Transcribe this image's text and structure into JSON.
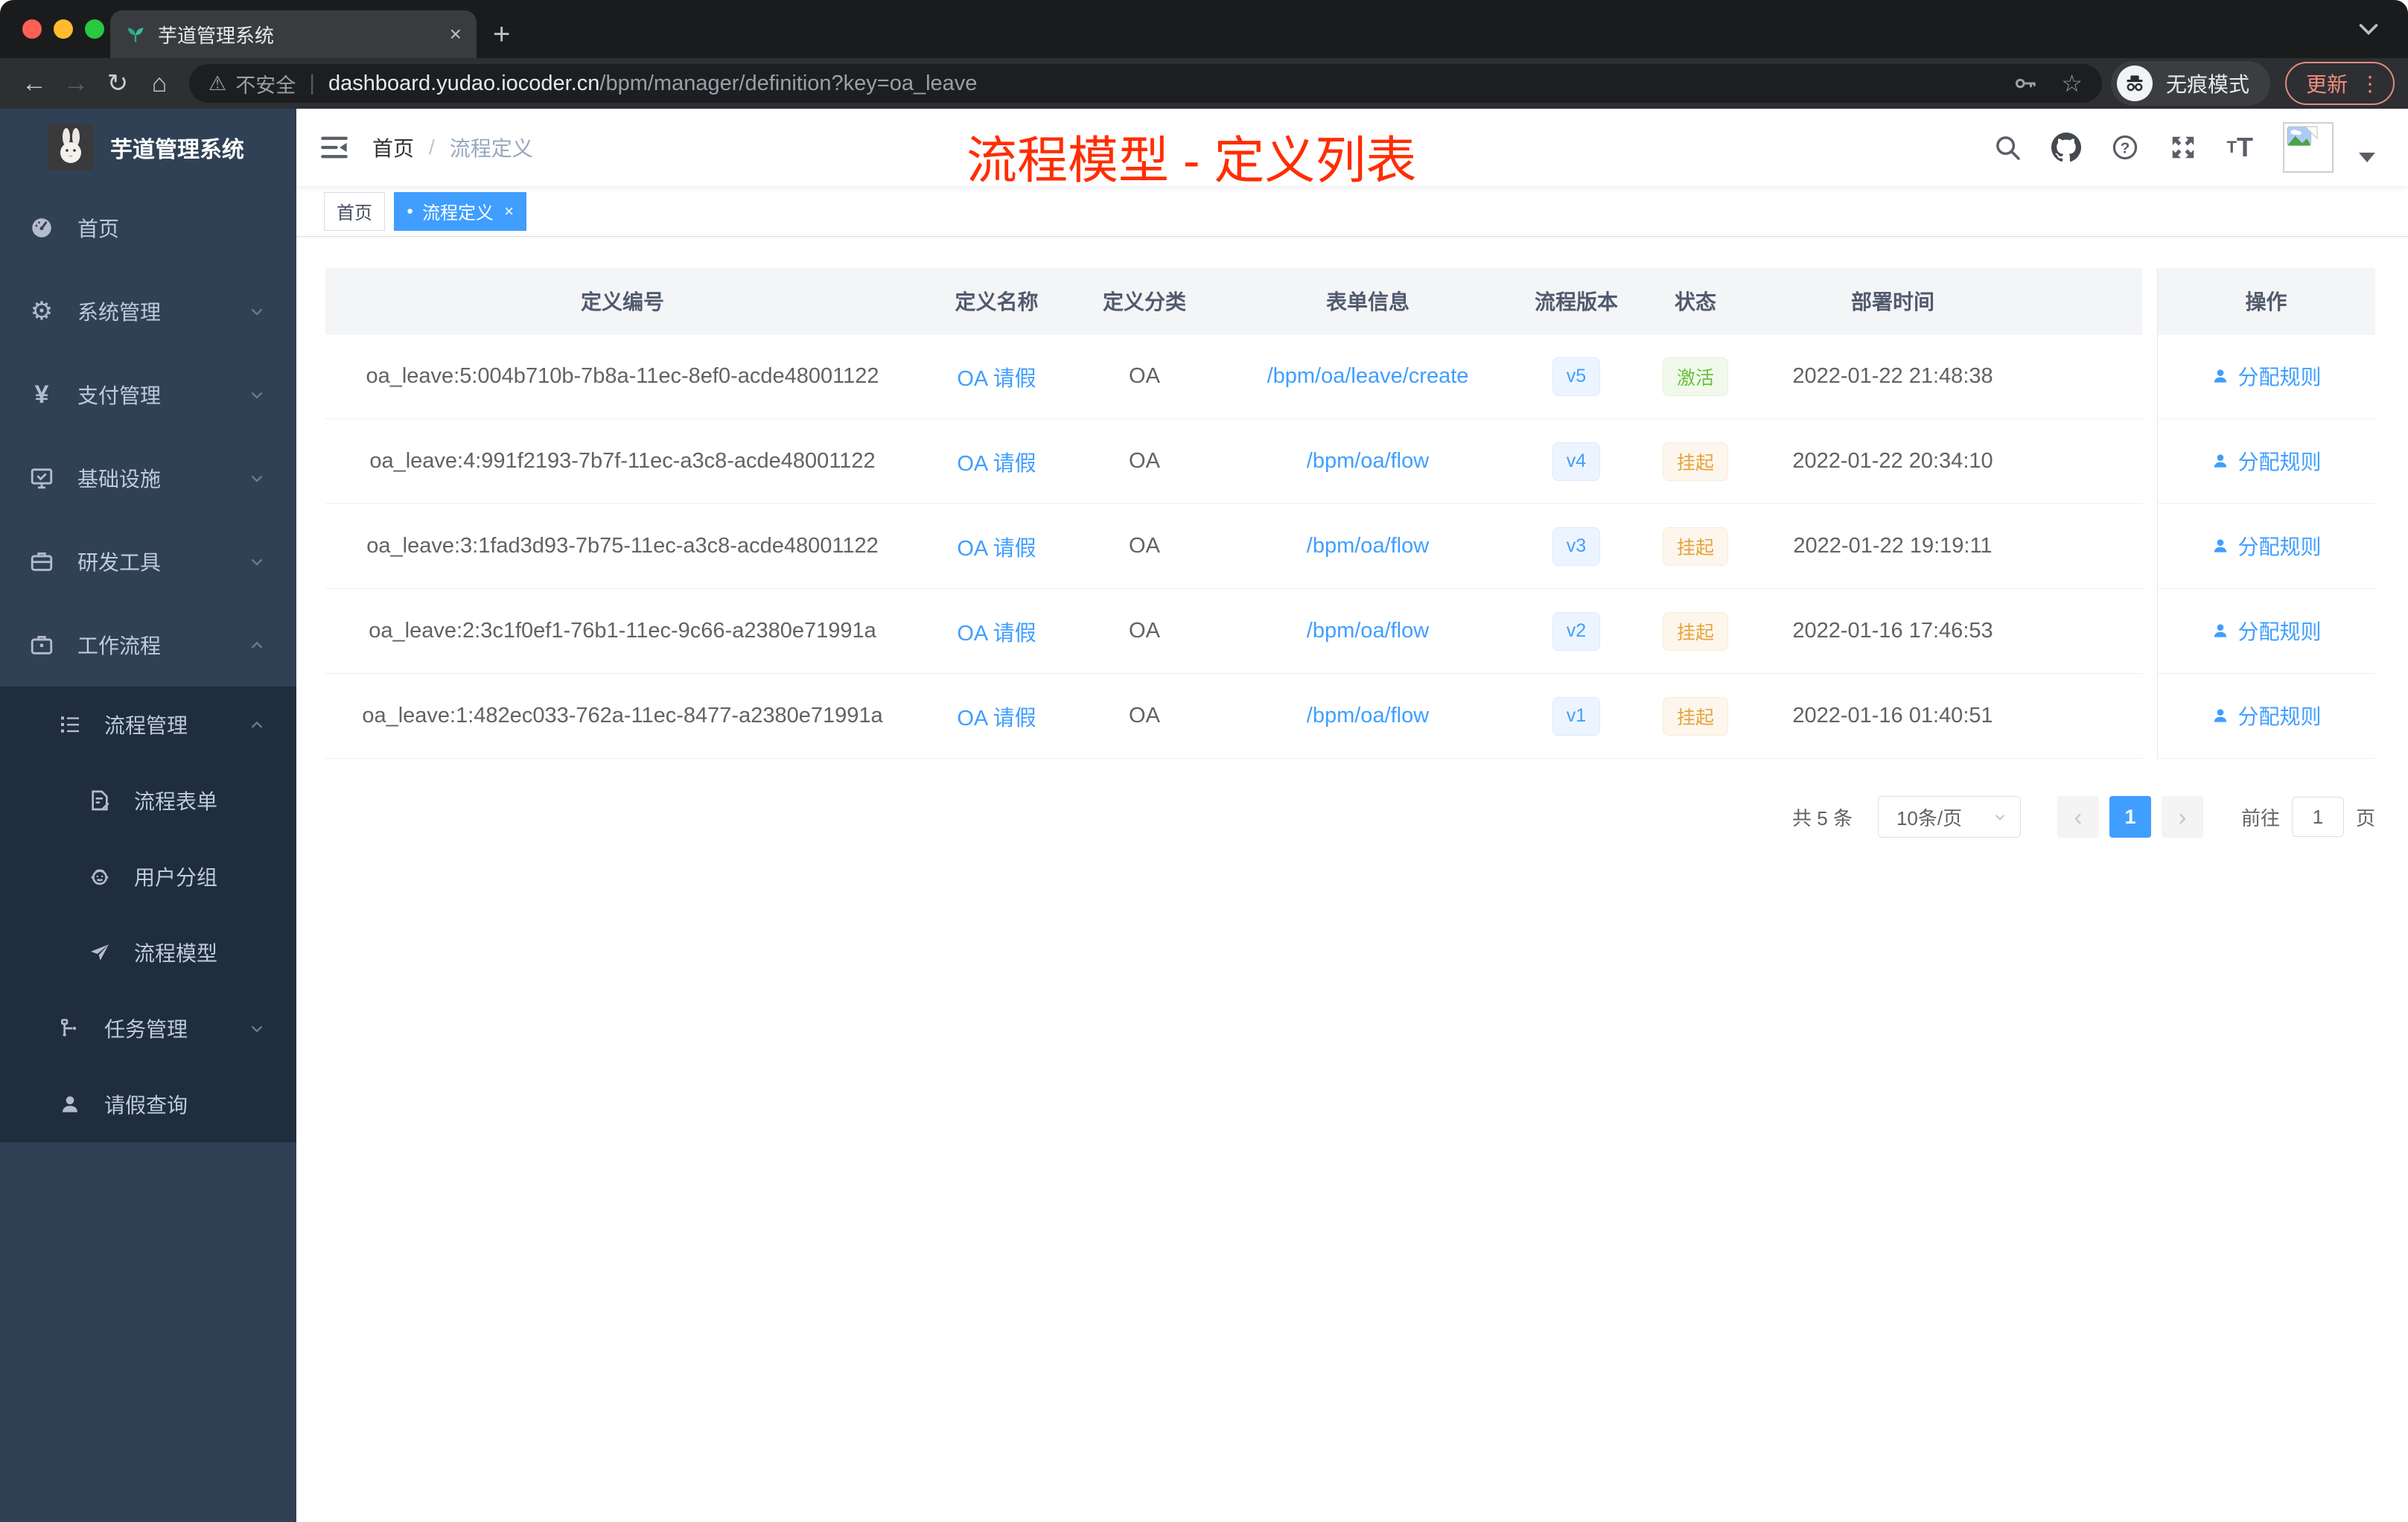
{
  "colors": {
    "accent": "#409EFF",
    "success": "#67C23A",
    "warning": "#E6A23C",
    "overlay_title_red": "#FF2D00",
    "sidebar_bg": "#304156",
    "submenu_bg": "#1F2D3D",
    "active_tag_bg": "#409EFF"
  },
  "browser": {
    "tab_title": "芋道管理系统",
    "address": {
      "warning": "不安全",
      "host": "dashboard.yudao.iocoder.cn",
      "path": "/bpm/manager/definition?key=oa_leave"
    },
    "incognito_label": "无痕模式",
    "update_label": "更新"
  },
  "icons": {
    "back": "←",
    "forward": "→",
    "reload": "↻",
    "home": "⌂",
    "warning": "⚠",
    "pipe": "|",
    "star": "☆",
    "kebab": "⋮",
    "tab_close": "×",
    "new_tab": "+",
    "yen": "¥",
    "gear": "⚙",
    "question": "?",
    "font_small": "T",
    "font_big": "T",
    "tag_dot": "●",
    "tag_close": "×",
    "prev": "‹",
    "next": "›"
  },
  "sidebar": {
    "logo_title": "芋道管理系统",
    "items": [
      {
        "label": "首页"
      },
      {
        "label": "系统管理"
      },
      {
        "label": "支付管理"
      },
      {
        "label": "基础设施"
      },
      {
        "label": "研发工具"
      },
      {
        "label": "工作流程"
      }
    ],
    "submenu": {
      "group": {
        "label": "流程管理"
      },
      "group_children": [
        {
          "label": "流程表单"
        },
        {
          "label": "用户分组"
        },
        {
          "label": "流程模型"
        }
      ],
      "items": [
        {
          "label": "任务管理"
        },
        {
          "label": "请假查询"
        }
      ]
    }
  },
  "header": {
    "breadcrumb": {
      "home": "首页",
      "separator": "/",
      "current": "流程定义"
    },
    "overlay_title": "流程模型 - 定义列表"
  },
  "tags": {
    "home": "首页",
    "active": "流程定义"
  },
  "table": {
    "columns": [
      "定义编号",
      "定义名称",
      "定义分类",
      "表单信息",
      "流程版本",
      "状态",
      "部署时间",
      "操作"
    ],
    "rows": [
      {
        "id": "oa_leave:5:004b710b-7b8a-11ec-8ef0-acde48001122",
        "name": "OA 请假",
        "category": "OA",
        "form": "/bpm/oa/leave/create",
        "version": "v5",
        "status": "激活",
        "deploy_time": "2022-01-22 21:48:38",
        "action": "分配规则"
      },
      {
        "id": "oa_leave:4:991f2193-7b7f-11ec-a3c8-acde48001122",
        "name": "OA 请假",
        "category": "OA",
        "form": "/bpm/oa/flow",
        "version": "v4",
        "status": "挂起",
        "deploy_time": "2022-01-22 20:34:10",
        "action": "分配规则"
      },
      {
        "id": "oa_leave:3:1fad3d93-7b75-11ec-a3c8-acde48001122",
        "name": "OA 请假",
        "category": "OA",
        "form": "/bpm/oa/flow",
        "version": "v3",
        "status": "挂起",
        "deploy_time": "2022-01-22 19:19:11",
        "action": "分配规则"
      },
      {
        "id": "oa_leave:2:3c1f0ef1-76b1-11ec-9c66-a2380e71991a",
        "name": "OA 请假",
        "category": "OA",
        "form": "/bpm/oa/flow",
        "version": "v2",
        "status": "挂起",
        "deploy_time": "2022-01-16 17:46:53",
        "action": "分配规则"
      },
      {
        "id": "oa_leave:1:482ec033-762a-11ec-8477-a2380e71991a",
        "name": "OA 请假",
        "category": "OA",
        "form": "/bpm/oa/flow",
        "version": "v1",
        "status": "挂起",
        "deploy_time": "2022-01-16 01:40:51",
        "action": "分配规则"
      }
    ]
  },
  "pagination": {
    "total": "共 5 条",
    "page_size": "10条/页",
    "page": "1",
    "goto_label": "前往",
    "goto_value": "1",
    "goto_unit": "页"
  }
}
